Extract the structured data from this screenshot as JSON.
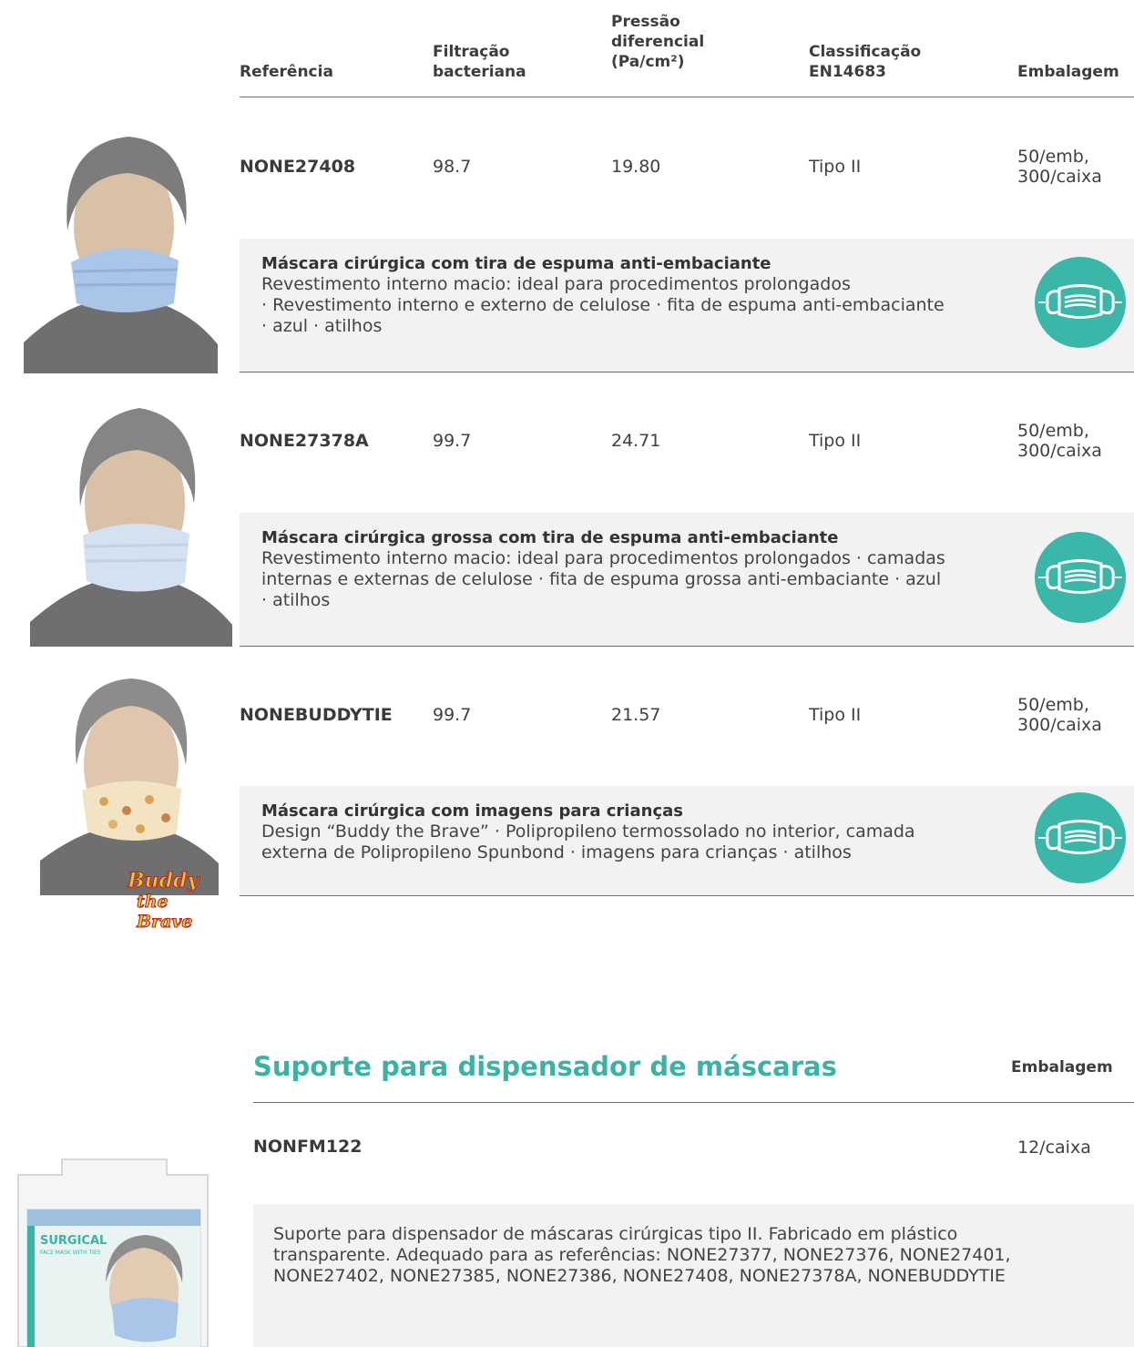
{
  "table": {
    "headers": {
      "reference": "Referência",
      "filtration": [
        "Filtração",
        "bacteriana"
      ],
      "pressure": [
        "Pressão",
        "diferencial",
        "(Pa/cm²)"
      ],
      "classification": [
        "Classificação",
        "EN14683"
      ],
      "packaging": "Embalagem"
    },
    "rows": [
      {
        "reference": "NONE27408",
        "filtration": "98.7",
        "pressure": "19.80",
        "classification": "Tipo II",
        "packaging": [
          "50/emb,",
          "300/caixa"
        ],
        "title": "Máscara cirúrgica com tira de espuma anti-embaciante",
        "lines": [
          "Revestimento interno macio: ideal para procedimentos prolongados",
          "· Revestimento interno e externo de celulose · fita de espuma anti-embaciante",
          "· azul · atilhos"
        ],
        "icon": "mask-icon"
      },
      {
        "reference": "NONE27378A",
        "filtration": "99.7",
        "pressure": "24.71",
        "classification": "Tipo II",
        "packaging": [
          "50/emb,",
          "300/caixa"
        ],
        "title": "Máscara cirúrgica grossa com tira de espuma anti-embaciante",
        "lines": [
          "Revestimento interno macio: ideal para procedimentos prolongados · camadas",
          "internas e externas de celulose · fita de espuma grossa anti-embaciante · azul",
          "· atilhos"
        ],
        "icon": "mask-icon"
      },
      {
        "reference": "NONEBUDDYTIE",
        "filtration": "99.7",
        "pressure": "21.57",
        "classification": "Tipo II",
        "packaging": [
          "50/emb,",
          "300/caixa"
        ],
        "title": "Máscara cirúrgica com imagens para crianças",
        "lines": [
          "Design “Buddy the Brave” · Polipropileno termossolado no interior, camada",
          "externa de Polipropileno Spunbond · imagens para crianças · atilhos"
        ],
        "icon": "mask-icon"
      }
    ]
  },
  "dispenser": {
    "title": "Suporte para dispensador de máscaras",
    "packaging_header": "Embalagem",
    "reference": "NONFM122",
    "packaging": "12/caixa",
    "lines": [
      "Suporte para dispensador de máscaras cirúrgicas tipo II. Fabricado em plástico",
      "transparente. Adequado para as referências: NONE27377, NONE27376, NONE27401,",
      "NONE27402, NONE27385, NONE27386, NONE27408, NONE27378A, NONEBUDDYTIE"
    ],
    "box_text": [
      "SURGICAL",
      "FACE MASK WITH TIES"
    ]
  },
  "logo": {
    "line1": "Buddy",
    "line2": "the Brave"
  },
  "colors": {
    "accent": "#3ab2a4",
    "panel": "#f2f2f2",
    "rule": "#6e6e6e"
  }
}
